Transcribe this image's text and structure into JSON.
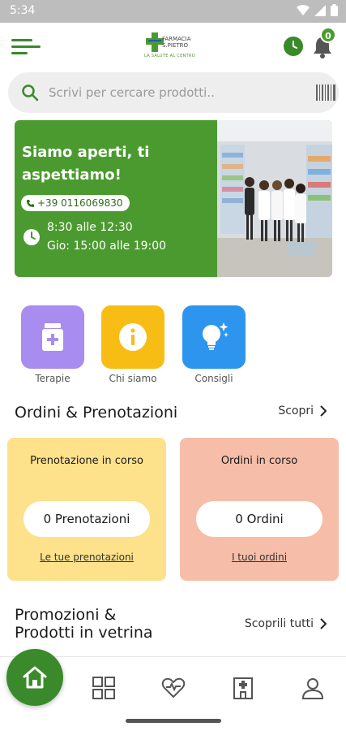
{
  "statusbar": {
    "time": "5:34"
  },
  "header": {
    "logo_name_line1": "FARMACIA",
    "logo_name_line2": "S.PIETRO",
    "logo_tagline": "LA SALUTE AL CENTRO",
    "notification_count": "0",
    "accent_color": "#3a8a2b"
  },
  "search": {
    "placeholder": "Scrivi per cercare prodotti.."
  },
  "hero": {
    "headline": "Siamo aperti, ti aspettiamo!",
    "phone": "+39 0116069830",
    "hours_line1": "8:30 alle 12:30",
    "hours_line2": "Gio: 15:00 alle 19:00",
    "background_color": "#4b9a2f"
  },
  "categories": [
    {
      "label": "Terapie",
      "icon": "medicine-bottle-icon",
      "color": "#a98cf0"
    },
    {
      "label": "Chi siamo",
      "icon": "info-icon",
      "color": "#f8bd14"
    },
    {
      "label": "Consigli",
      "icon": "lightbulb-icon",
      "color": "#2e95ee"
    }
  ],
  "orders_section": {
    "title": "Ordini & Prenotazioni",
    "link": "Scopri",
    "bookings_card": {
      "title": "Prenotazione in corso",
      "value": "0 Prenotazioni",
      "link": "Le tue prenotazioni",
      "color": "#fde18b"
    },
    "orders_card": {
      "title": "Ordini in corso",
      "value": "0 Ordini",
      "link": "I tuoi ordini",
      "color": "#f6bda8"
    }
  },
  "promo_section": {
    "title_line1": "Promozioni &",
    "title_line2": "Prodotti in vetrina",
    "link": "Scoprili tutti"
  },
  "bottom_nav": [
    {
      "name": "home",
      "icon": "home-icon",
      "active": true
    },
    {
      "name": "catalog",
      "icon": "grid-icon",
      "active": false
    },
    {
      "name": "health",
      "icon": "heart-pulse-icon",
      "active": false
    },
    {
      "name": "pharmacy",
      "icon": "building-icon",
      "active": false
    },
    {
      "name": "profile",
      "icon": "user-icon",
      "active": false
    }
  ]
}
